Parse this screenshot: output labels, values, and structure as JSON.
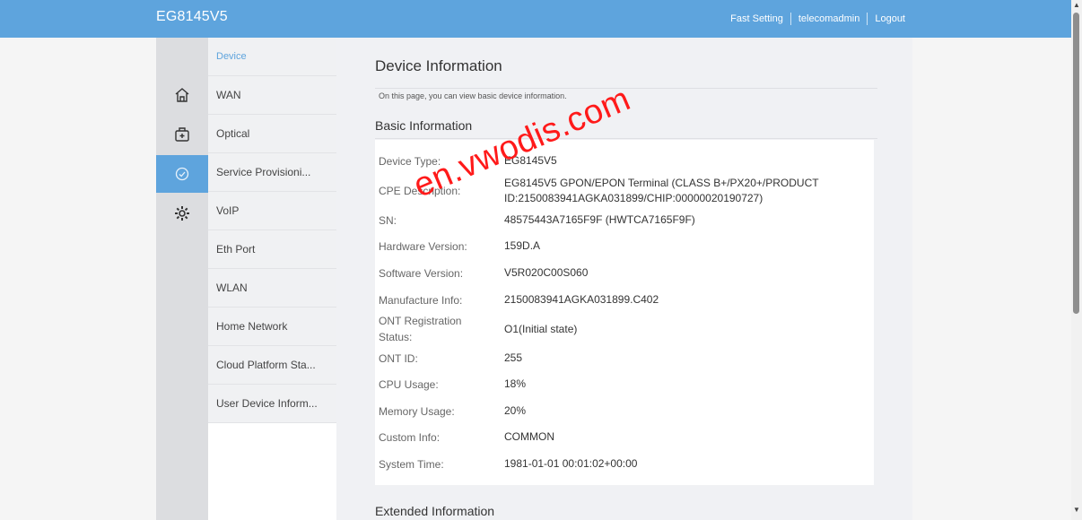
{
  "header": {
    "brand": "EG8145V5",
    "links": [
      "Fast Setting",
      "telecomadmin",
      "Logout"
    ]
  },
  "sidebar": {
    "icons": [
      "home-icon",
      "medkit-icon",
      "service-check-icon",
      "gear-icon"
    ],
    "active_icon": "service-check-icon"
  },
  "menu": {
    "items": [
      "Device",
      "WAN",
      "Optical",
      "Service Provisioni...",
      "VoIP",
      "Eth Port",
      "WLAN",
      "Home Network",
      "Cloud Platform Sta...",
      "User Device Inform..."
    ],
    "active": "Device"
  },
  "page": {
    "title": "Device Information",
    "description": "On this page, you can view basic device information.",
    "basic_section": "Basic Information",
    "extended_section": "Extended Information",
    "rows": [
      {
        "label": "Device Type:",
        "value": "EG8145V5"
      },
      {
        "label": "CPE Description:",
        "value": "EG8145V5 GPON/EPON Terminal (CLASS B+/PX20+/PRODUCT ID:2150083941AGKA031899/CHIP:00000020190727)"
      },
      {
        "label": "SN:",
        "value": "48575443A7165F9F (HWTCA7165F9F)"
      },
      {
        "label": "Hardware Version:",
        "value": "159D.A"
      },
      {
        "label": "Software Version:",
        "value": "V5R020C00S060"
      },
      {
        "label": "Manufacture Info:",
        "value": "2150083941AGKA031899.C402"
      },
      {
        "label": "ONT Registration Status:",
        "value": "O1(Initial state)"
      },
      {
        "label": "ONT ID:",
        "value": "255"
      },
      {
        "label": "CPU Usage:",
        "value": "18%"
      },
      {
        "label": "Memory Usage:",
        "value": "20%"
      },
      {
        "label": "Custom Info:",
        "value": "COMMON"
      },
      {
        "label": "System Time:",
        "value": "1981-01-01 00:01:02+00:00"
      }
    ]
  },
  "watermark": "en.vwodis.com",
  "colors": {
    "accent": "#5ea4dd",
    "watermark": "#ff1a1a"
  }
}
